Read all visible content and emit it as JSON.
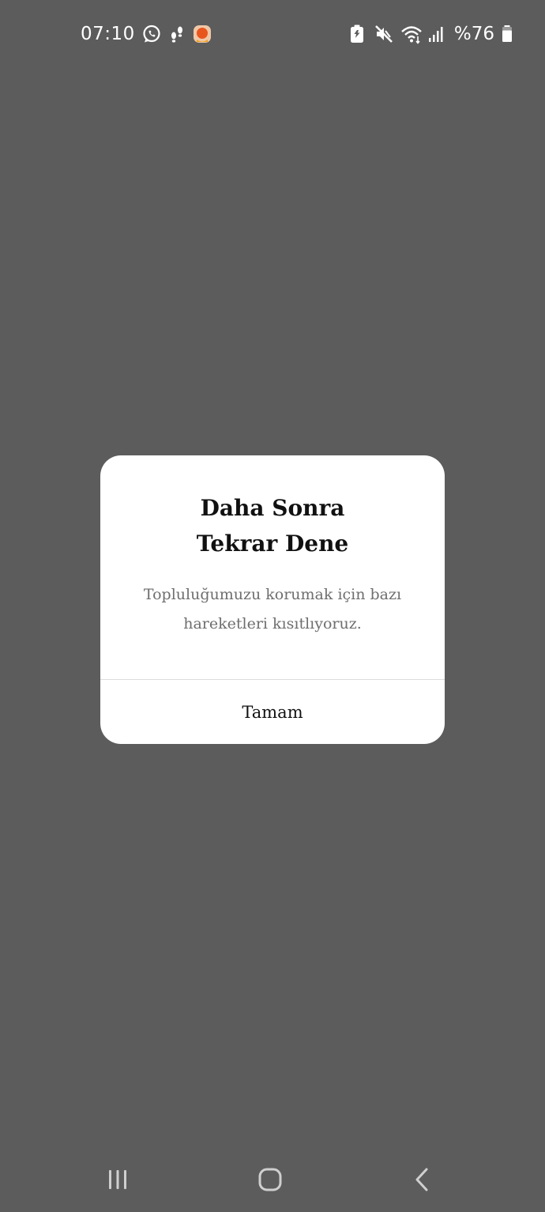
{
  "status_bar": {
    "time": "07:10",
    "left_icons": [
      "whatsapp-icon",
      "footsteps-icon",
      "app-notification-icon"
    ],
    "right_icons": [
      "battery-saver-icon",
      "mute-icon",
      "wifi-icon",
      "signal-icon"
    ],
    "battery_text": "%76",
    "battery_level": 0.76
  },
  "dialog": {
    "title_line1": "Daha Sonra",
    "title_line2": "Tekrar Dene",
    "message_line1": "Topluluğumuzu korumak için bazı",
    "message_line2": "hareketleri kısıtlıyoruz.",
    "button_label": "Tamam"
  },
  "nav_bar": {
    "buttons": [
      "recent-apps",
      "home",
      "back"
    ]
  },
  "colors": {
    "background": "#5c5c5c",
    "dialog": "#ffffff",
    "text_primary": "#111111",
    "text_secondary": "#6e6e6e",
    "nav_icon": "#cfcfcf"
  }
}
